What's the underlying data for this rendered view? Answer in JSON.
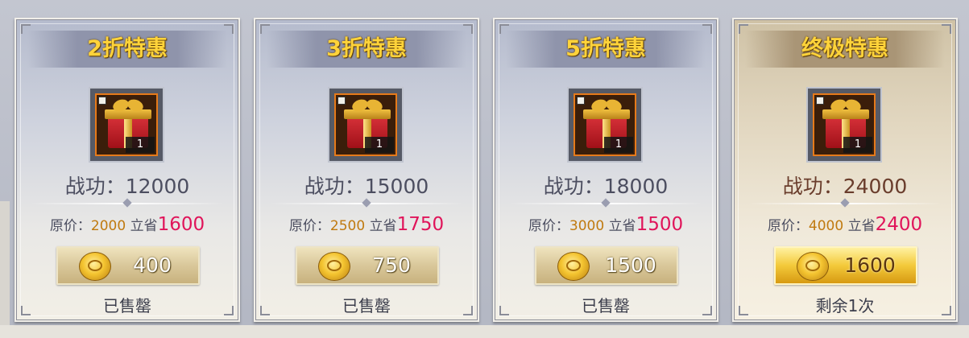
{
  "cards": [
    {
      "banner": "2折特惠",
      "quantity": "1",
      "merit": "战功：12000",
      "original_label": "原价：",
      "original_price": "2000",
      "save_label": "立省",
      "save_amount": "1600",
      "price": "400",
      "status": "已售罄"
    },
    {
      "banner": "3折特惠",
      "quantity": "1",
      "merit": "战功：15000",
      "original_label": "原价：",
      "original_price": "2500",
      "save_label": "立省",
      "save_amount": "1750",
      "price": "750",
      "status": "已售罄"
    },
    {
      "banner": "5折特惠",
      "quantity": "1",
      "merit": "战功：18000",
      "original_label": "原价：",
      "original_price": "3000",
      "save_label": "立省",
      "save_amount": "1500",
      "price": "1500",
      "status": "已售罄"
    },
    {
      "banner": "终极特惠",
      "quantity": "1",
      "merit": "战功：24000",
      "original_label": "原价：",
      "original_price": "4000",
      "save_label": "立省",
      "save_amount": "2400",
      "price": "1600",
      "status": "剩余1次"
    }
  ],
  "icons": {
    "item": "gift-box-icon",
    "currency": "gold-coin-icon"
  },
  "colors": {
    "banner_text": "#ffd33a",
    "original_price": "#c07a10",
    "save_amount": "#e0145a",
    "active_button": "#f3c93a"
  }
}
